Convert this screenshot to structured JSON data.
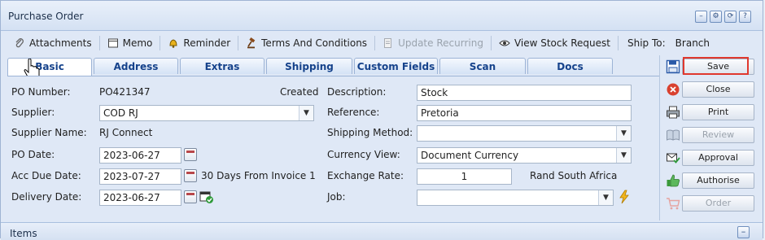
{
  "window": {
    "title": "Purchase Order"
  },
  "title_icons": [
    "minimize-icon",
    "gear-icon",
    "refresh-icon",
    "help-icon"
  ],
  "toolbar": {
    "attachments": "Attachments",
    "memo": "Memo",
    "reminder": "Reminder",
    "terms": "Terms And Conditions",
    "update_recurring": "Update Recurring",
    "view_stock": "View Stock Request",
    "ship_to_label": "Ship To:",
    "ship_to_value": "Branch"
  },
  "tabs": [
    "Basic",
    "Address",
    "Extras",
    "Shipping",
    "Custom Fields",
    "Scan",
    "Docs"
  ],
  "active_tab": "Basic",
  "form": {
    "po_number_label": "PO Number:",
    "po_number": "PO421347",
    "status": "Created",
    "supplier_label": "Supplier:",
    "supplier": "COD RJ",
    "supplier_name_label": "Supplier Name:",
    "supplier_name": "RJ Connect",
    "po_date_label": "PO Date:",
    "po_date": "2023-06-27",
    "acc_due_label": "Acc Due Date:",
    "acc_due": "2023-07-27",
    "acc_due_terms": "30 Days From Invoice 1",
    "delivery_label": "Delivery Date:",
    "delivery": "2023-06-27",
    "description_label": "Description:",
    "description": "Stock",
    "reference_label": "Reference:",
    "reference": "Pretoria",
    "shipping_method_label": "Shipping Method:",
    "shipping_method": "",
    "currency_view_label": "Currency View:",
    "currency_view": "Document Currency",
    "exchange_rate_label": "Exchange Rate:",
    "exchange_rate": "1",
    "currency_name": "Rand South Africa",
    "job_label": "Job:",
    "job": ""
  },
  "actions": {
    "save": "Save",
    "close": "Close",
    "print": "Print",
    "review": "Review",
    "approval": "Approval",
    "authorise": "Authorise",
    "order": "Order"
  },
  "items_panel": {
    "title": "Items"
  },
  "colors": {
    "highlight": "#e0382e",
    "tab_text": "#15428b",
    "panel_bg": "#dfe8f6"
  }
}
